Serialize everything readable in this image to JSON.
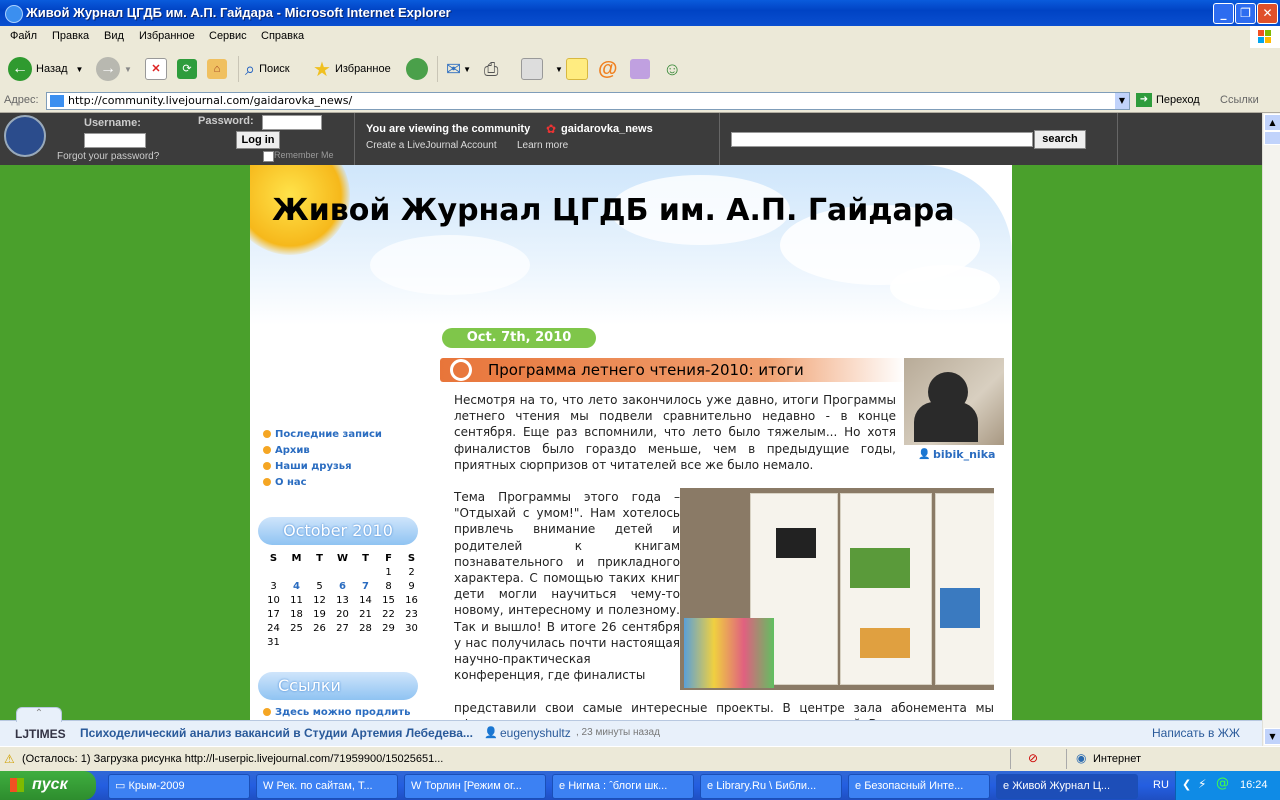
{
  "window": {
    "title": "Живой Журнал ЦГДБ им. А.П. Гайдара - Microsoft Internet Explorer"
  },
  "menu": [
    "Файл",
    "Правка",
    "Вид",
    "Избранное",
    "Сервис",
    "Справка"
  ],
  "toolbar": {
    "back": "Назад",
    "search": "Поиск",
    "favorites": "Избранное"
  },
  "address": {
    "label": "Адрес:",
    "url": "http://community.livejournal.com/gaidarovka_news/",
    "go": "Переход",
    "links": "Ссылки"
  },
  "lj_header": {
    "username_label": "Username:",
    "password_label": "Password:",
    "login": "Log in",
    "forgot": "Forgot your password?",
    "remember": "Remember Me",
    "viewing": "You are viewing the community",
    "community": "gaidarovka_news",
    "create": "Create a LiveJournal Account",
    "learn": "Learn more",
    "search_button": "search"
  },
  "journal": {
    "title": "Живой Журнал ЦГДБ им. А.П. Гайдара",
    "date": "Oct. 7th, 2010",
    "post_title": "Программа летнего чтения-2010: итоги",
    "author": "bibik_nika",
    "para1": "Несмотря на то, что лето закончилось уже давно, итоги Программы летнего чтения мы подвели сравнительно недавно - в конце сентября. Еще раз вспомнили, что лето было тяжелым... Но хотя финалистов было гораздо меньше, чем в предыдущие годы, приятных сюрпризов от читателей все же было немало.",
    "para2": "Тема Программы этого года – \"Отдыхай с умом!\". Нам хотелось привлечь внимание детей и родителей к книгам познавательного и прикладного характера. С помощью таких книг дети могли научиться чему-то новому, интересному и полезному. Так и вышло! В итоге 26 сентября у нас получилась почти настоящая научно-практическая конференция, где финалисты",
    "para3": "представили свои самые интересные проекты. В центре зала абонемента мы оформили выставки из читательских дневников и презентаций. Все это"
  },
  "sidebar": {
    "nav": [
      "Последние записи",
      "Архив",
      "Наши друзья",
      "О нас"
    ],
    "calendar_title": "October 2010",
    "weekdays": [
      "S",
      "M",
      "T",
      "W",
      "T",
      "F",
      "S"
    ],
    "weeks": [
      [
        "",
        "",
        "",
        "",
        "",
        "1",
        "2"
      ],
      [
        "3",
        "4",
        "5",
        "6",
        "7",
        "8",
        "9"
      ],
      [
        "10",
        "11",
        "12",
        "13",
        "14",
        "15",
        "16"
      ],
      [
        "17",
        "18",
        "19",
        "20",
        "21",
        "22",
        "23"
      ],
      [
        "24",
        "25",
        "26",
        "27",
        "28",
        "29",
        "30"
      ],
      [
        "31",
        "",
        "",
        "",
        "",
        "",
        ""
      ]
    ],
    "linked_days": [
      "4",
      "6",
      "7"
    ],
    "links_title": "Ссылки",
    "link1": "Здесь можно продлить"
  },
  "ljtimes": {
    "logo": "LJTIMES",
    "headline": "Психоделический анализ вакансий в Студии Артемия Лебедева...",
    "user": "eugenyshultz",
    "ago": ", 23 минуты назад",
    "write": "Написать в ЖЖ"
  },
  "status": {
    "text": "(Осталось: 1) Загрузка рисунка http://l-userpic.livejournal.com/71959900/15025651...",
    "zone": "Интернет"
  },
  "taskbar": {
    "start": "пуск",
    "tasks": [
      "Крым-2009",
      "Рек. по сайтам, Т...",
      "Торлин [Режим ог...",
      "Нигма : ˆблоги шк...",
      "Library.Ru \\ Библи...",
      "Безопасный Инте...",
      "Живой Журнал Ц..."
    ],
    "lang": "RU",
    "time": "16:24"
  },
  "colors": {
    "page_bg": "#4aa02c",
    "lj_bar": "#3c3c3c",
    "accent_orange": "#e8753a",
    "date_pill": "#7fc64a"
  }
}
